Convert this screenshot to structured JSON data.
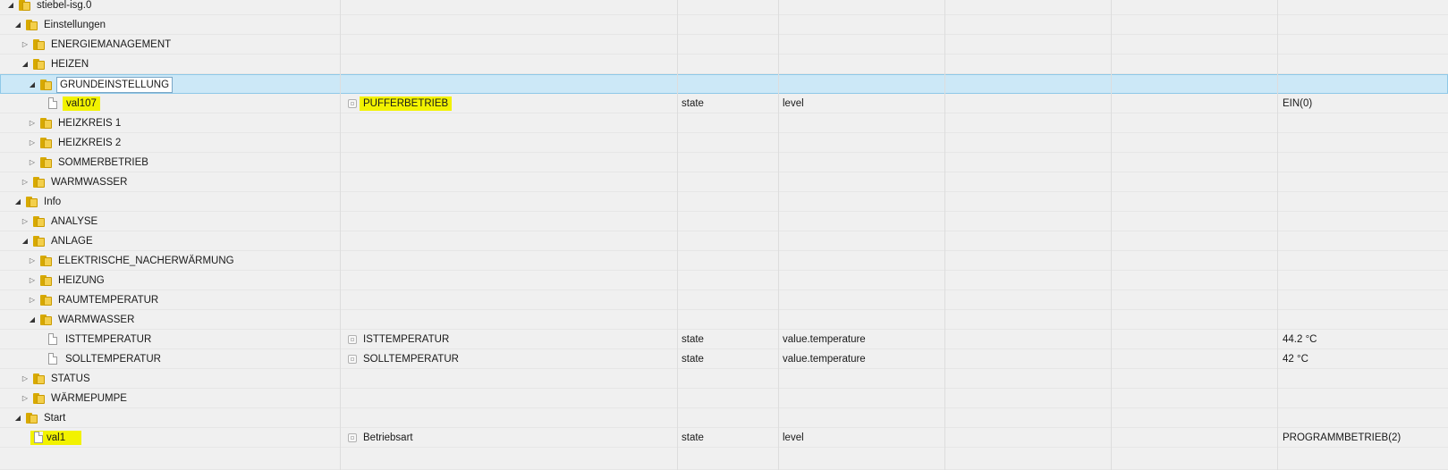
{
  "tree": {
    "root": {
      "label": "stiebel-isg.0"
    },
    "rows": [
      {
        "label": "Einstellungen"
      },
      {
        "label": "ENERGIEMANAGEMENT"
      },
      {
        "label": "HEIZEN"
      },
      {
        "label": "GRUNDEINSTELLUNG"
      },
      {
        "label": "val107",
        "name": "PUFFERBETRIEB",
        "type": "state",
        "role": "level",
        "value": "EIN(0)"
      },
      {
        "label": "HEIZKREIS 1"
      },
      {
        "label": "HEIZKREIS 2"
      },
      {
        "label": "SOMMERBETRIEB"
      },
      {
        "label": "WARMWASSER"
      },
      {
        "label": "Info"
      },
      {
        "label": "ANALYSE"
      },
      {
        "label": "ANLAGE"
      },
      {
        "label": "ELEKTRISCHE_NACHERWÄRMUNG"
      },
      {
        "label": "HEIZUNG"
      },
      {
        "label": "RAUMTEMPERATUR"
      },
      {
        "label": "WARMWASSER"
      },
      {
        "label": "ISTTEMPERATUR",
        "name": "ISTTEMPERATUR",
        "type": "state",
        "role": "value.temperature",
        "value": "44.2 °C"
      },
      {
        "label": "SOLLTEMPERATUR",
        "name": "SOLLTEMPERATUR",
        "type": "state",
        "role": "value.temperature",
        "value": "42 °C"
      },
      {
        "label": "STATUS"
      },
      {
        "label": "WÄRMEPUMPE"
      },
      {
        "label": "Start"
      },
      {
        "label": "val1",
        "name": "Betriebsart",
        "type": "state",
        "role": "level",
        "value": "PROGRAMMBETRIEB(2)"
      }
    ]
  },
  "icons": {
    "folder": "folder-icon",
    "file": "file-icon",
    "expanded": "triangle-expanded-icon",
    "collapsed": "triangle-collapsed-icon",
    "state": "state-icon",
    "logo": "adapter-logo-icon"
  },
  "colors": {
    "selection": "#cce8f7",
    "highlight": "#f2f200",
    "folder": "#f3cf4b"
  }
}
